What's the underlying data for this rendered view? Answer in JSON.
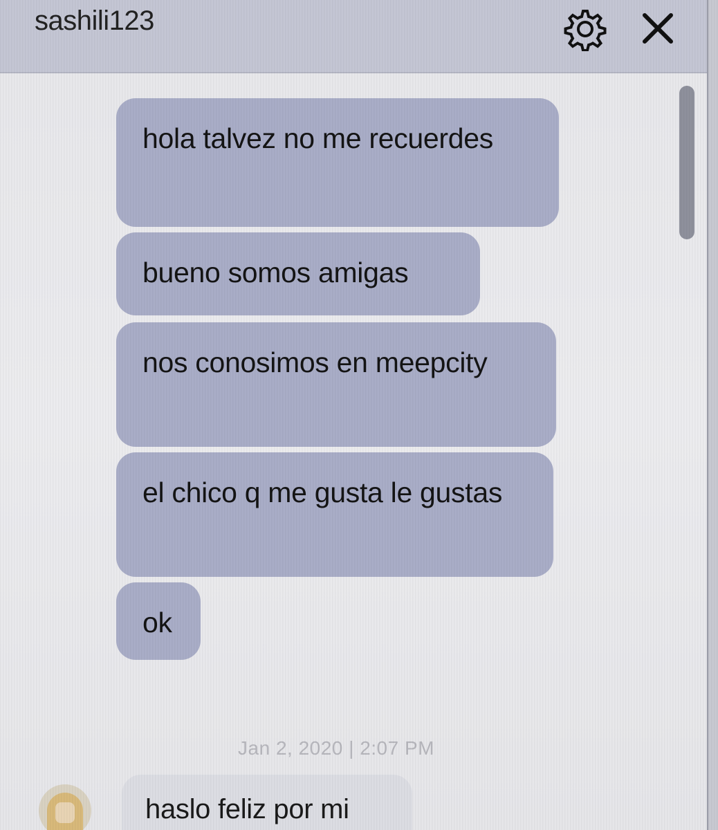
{
  "header": {
    "title": "sashili123",
    "settings_icon": "gear-icon",
    "close_icon": "close-icon"
  },
  "messages": {
    "outgoing": [
      "hola talvez no me recuerdes",
      "bueno somos amigas",
      "nos conosimos en meepcity",
      "el chico q me gusta le gustas",
      "ok"
    ],
    "timestamp": "Jan 2, 2020 | 2:07 PM",
    "incoming": [
      {
        "avatar": "avatar",
        "text": "haslo feliz por mi"
      }
    ]
  },
  "colors": {
    "header": "#c4c6d4",
    "outgoing_bubble": "#a9adc7",
    "incoming_bubble": "#dcdde3",
    "background": "#e8e8eb"
  }
}
